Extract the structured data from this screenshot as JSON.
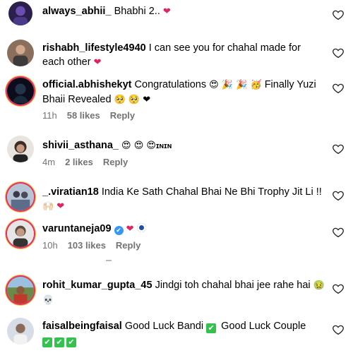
{
  "comments": [
    {
      "username": "always_abhii_",
      "text": "Bhabhi 2..",
      "emoji": "❤"
    },
    {
      "username": "rishabh_lifestyle4940",
      "text": "I can see you for chahal made for each other",
      "emoji": "❤"
    },
    {
      "username": "official.abhishekyt",
      "text": "Congratulations",
      "emoji_mid": "😍 🎉 🎉 🥳",
      "text2": "Finally Yuzi Bhaii Revealed",
      "emoji_end": "🥺 🥺 ❤",
      "time": "11h",
      "likes": "58 likes",
      "reply": "Reply"
    },
    {
      "username": "shivii_asthana_",
      "emoji": "😍 😍 😍",
      "text": "ɪɴɪɴ",
      "time": "4m",
      "likes": "2 likes",
      "reply": "Reply"
    },
    {
      "username": "_.viratian18",
      "text": "India Ke Sath Chahal Bhai Ne Bhi Trophy Jit Li !!",
      "emoji": "🙌🏻",
      "emoji2": "❤"
    },
    {
      "username": "varuntaneja09",
      "verified": "✔",
      "emoji": "❤",
      "time": "10h",
      "likes": "103 likes",
      "reply": "Reply"
    },
    {
      "username": "rohit_kumar_gupta_45",
      "text": "Jindgi toh chahal bhai jee rahe hai",
      "emoji": "🤢",
      "emoji2": "💀"
    },
    {
      "username": "faisalbeingfaisal",
      "text": "Good Luck Bandi",
      "check": "✔",
      "text2": "Good Luck Couple"
    }
  ],
  "icons": {
    "like": "heart-outline-icon"
  },
  "colors": {
    "meta": "#737373",
    "heart": "#e0245e",
    "ring": "#e1306c"
  }
}
